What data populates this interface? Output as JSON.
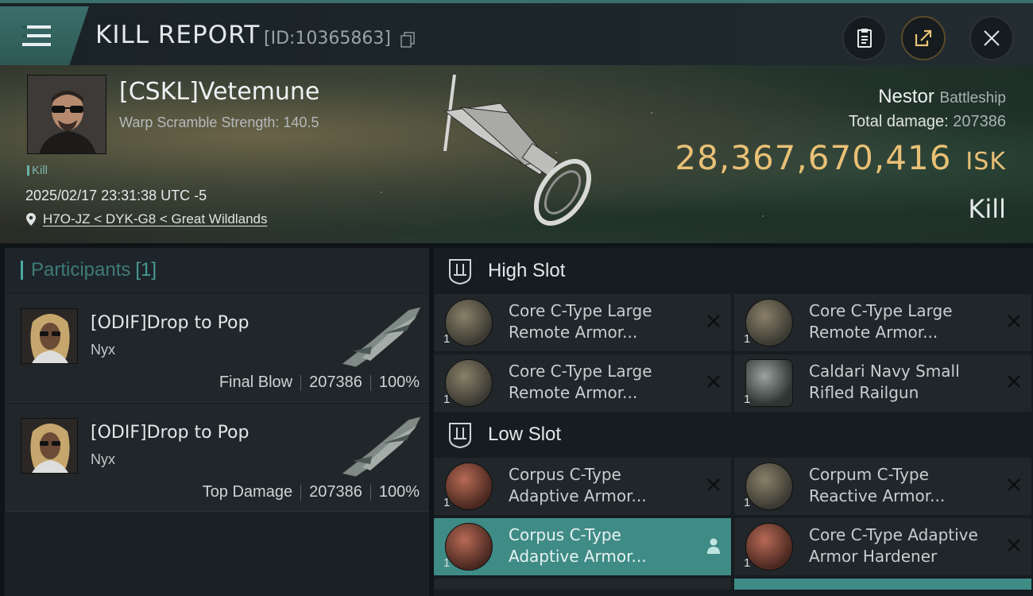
{
  "header": {
    "title": "KILL REPORT",
    "id_text": "[ID:10365863]",
    "buttons": [
      "clipboard",
      "share",
      "close"
    ]
  },
  "victim": {
    "name": "[CSKL]Vetemune",
    "warp_scramble": "Warp Scramble Strength: 140.5",
    "kill_tag": "Kill",
    "datetime": "2025/02/17 23:31:38 UTC -5",
    "location": "H7O-JZ < DYK-G8 < Great Wildlands",
    "ship_name": "Nestor",
    "ship_class": "Battleship",
    "total_damage_label": "Total damage:",
    "total_damage": "207386",
    "isk_value": "28,367,670,416",
    "isk_unit": "ISK",
    "result": "Kill"
  },
  "participants": {
    "title": "Participants",
    "count": "[1]",
    "rows": [
      {
        "name": "[ODIF]Drop to Pop",
        "ship": "Nyx",
        "role": "Final Blow",
        "damage": "207386",
        "percent": "100%"
      },
      {
        "name": "[ODIF]Drop to Pop",
        "ship": "Nyx",
        "role": "Top Damage",
        "damage": "207386",
        "percent": "100%"
      }
    ]
  },
  "fitting": {
    "high_slot": {
      "label": "High Slot",
      "modules": [
        {
          "qty": "1",
          "line1": "Core C-Type Large",
          "line2": "Remote Armor...",
          "icon": "remote-armor-icon"
        },
        {
          "qty": "1",
          "line1": "Core C-Type Large",
          "line2": "Remote Armor...",
          "icon": "remote-armor-icon"
        },
        {
          "qty": "1",
          "line1": "Core C-Type Large",
          "line2": "Remote Armor...",
          "icon": "remote-armor-icon"
        },
        {
          "qty": "1",
          "line1": "Caldari Navy Small",
          "line2": "Rifled Railgun",
          "icon": "railgun-icon"
        }
      ]
    },
    "low_slot": {
      "label": "Low Slot",
      "modules": [
        {
          "qty": "1",
          "line1": "Corpus C-Type",
          "line2": "Adaptive Armor...",
          "icon": "armor-hardener-icon"
        },
        {
          "qty": "1",
          "line1": "Corpum C-Type",
          "line2": "Reactive Armor...",
          "icon": "reactive-armor-icon"
        },
        {
          "qty": "1",
          "line1": "Corpus C-Type",
          "line2": "Adaptive Armor...",
          "icon": "armor-hardener-icon",
          "selected": true
        },
        {
          "qty": "1",
          "line1": "Core C-Type Adaptive",
          "line2": "Armor Hardener",
          "icon": "armor-hardener-icon"
        }
      ]
    }
  }
}
